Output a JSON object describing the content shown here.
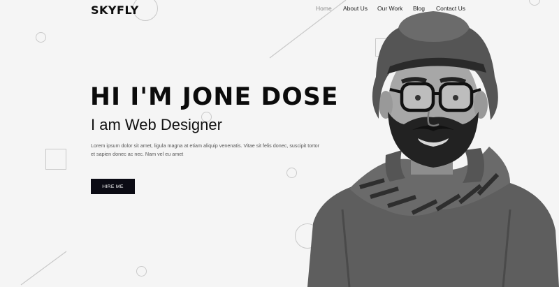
{
  "brand": {
    "logo_text": "SKYFLY"
  },
  "nav": {
    "items": [
      {
        "label": "Home",
        "active": true
      },
      {
        "label": "About Us",
        "active": false
      },
      {
        "label": "Our Work",
        "active": false
      },
      {
        "label": "Blog",
        "active": false
      },
      {
        "label": "Contact Us",
        "active": false
      }
    ]
  },
  "hero": {
    "title": "HI I'M JONE DOSE",
    "subtitle": "I am Web Designer",
    "description": "Lorem ipsum dolor sit amet, ligula magna at etiam aliquip venenatis. Vitae sit felis donec, suscipit tortor et sapien donec ac nec. Nam vel eu amet",
    "cta_label": "HIRE ME"
  },
  "colors": {
    "background": "#f5f5f5",
    "text": "#111111",
    "button_bg": "#0b0b14",
    "nav_active": "#8a8a8a",
    "decoration": "#c9c9c9"
  },
  "images": {
    "portrait": "grayscale-portrait-man-hat-glasses-scarf"
  }
}
